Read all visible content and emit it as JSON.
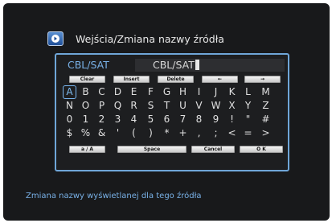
{
  "header": {
    "icon": "input-source-icon",
    "title": "Wejścia/Zmiana nazwy źródła"
  },
  "editor": {
    "label": "CBL/SAT",
    "value": "CBL/SAT"
  },
  "top_buttons": [
    "Clear",
    "Insert",
    "Delete",
    "←",
    "→"
  ],
  "keyboard_rows": [
    [
      "A",
      "B",
      "C",
      "D",
      "E",
      "F",
      "G",
      "H",
      "I",
      "J",
      "K",
      "L",
      "M"
    ],
    [
      "N",
      "O",
      "P",
      "Q",
      "R",
      "S",
      "T",
      "U",
      "V",
      "W",
      "X",
      "Y",
      "Z"
    ],
    [
      "0",
      "1",
      "2",
      "3",
      "4",
      "5",
      "6",
      "7",
      "8",
      "9",
      "!",
      "\"",
      "#"
    ],
    [
      "$",
      "%",
      "&",
      "'",
      "(",
      ")",
      "*",
      "+",
      ",",
      ";",
      "<",
      "=",
      ">"
    ]
  ],
  "selected_key": "A",
  "bottom_buttons": [
    "a / A",
    "Space",
    "Cancel",
    "O K"
  ],
  "footer": {
    "hint": "Zmiana nazwy wyświetlanej dla tego źródła"
  },
  "colors": {
    "accent": "#78b0e6",
    "panel_border": "#6fa6d8",
    "background": "#18191b"
  }
}
